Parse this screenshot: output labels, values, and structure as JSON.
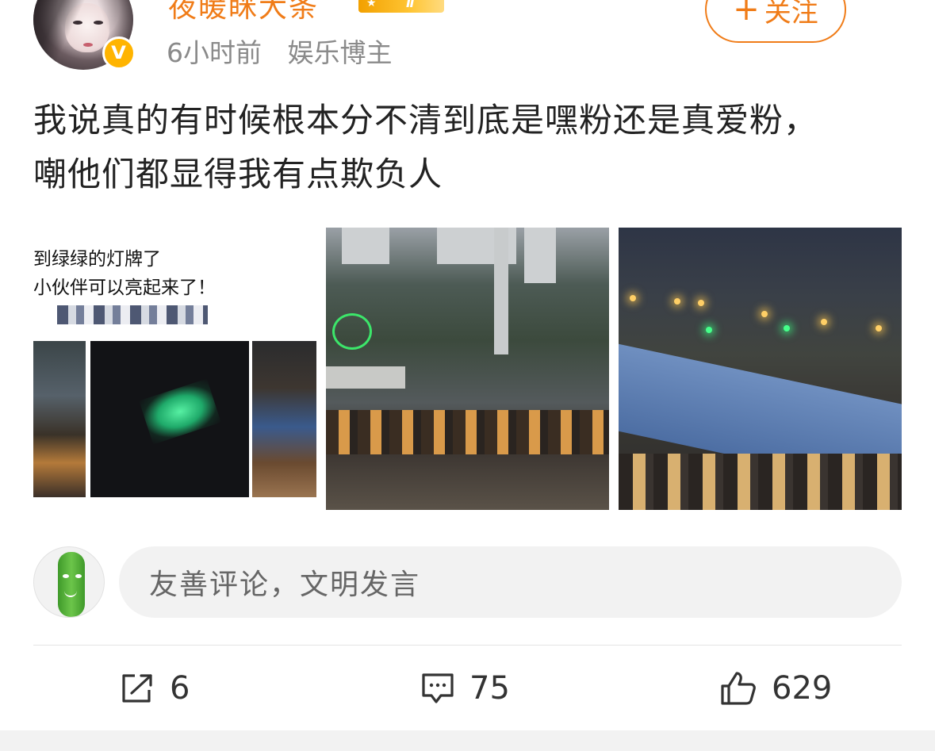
{
  "author": {
    "name": "夜暖眯大条",
    "level_badge": "Ⅱ",
    "time": "6小时前",
    "tag": "娱乐博主",
    "verified_icon": "v-verified-icon",
    "follow_label": "关注"
  },
  "post": {
    "text": "我说真的有时候根本分不清到底是嘿粉还是真爱粉，嘲他们都显得我有点欺负人"
  },
  "images": {
    "img1_caption_line1": "到绿绿的灯牌了",
    "img1_caption_line2": "小伙伴可以亮起来了！"
  },
  "comment": {
    "placeholder": "友善评论，文明发言"
  },
  "actions": {
    "share_count": "6",
    "comment_count": "75",
    "like_count": "629"
  },
  "colors": {
    "accent": "#f07c18",
    "badge_gold": "#ffb400",
    "text": "#222222",
    "muted": "#8a8a8a",
    "input_bg": "#f2f2f2"
  }
}
